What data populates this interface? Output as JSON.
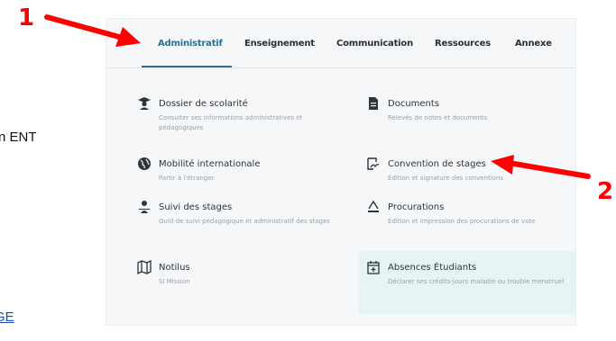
{
  "doc": {
    "ent_text": "n ENT",
    "link_text": "GE"
  },
  "tabs": [
    {
      "label": "Administratif",
      "active": true
    },
    {
      "label": "Enseignement"
    },
    {
      "label": "Communication"
    },
    {
      "label": "Ressources"
    },
    {
      "label": "Annexe"
    }
  ],
  "cards": {
    "scolarite": {
      "title": "Dossier de scolarité",
      "desc": "Consulter ses informations administratives et pédagogiques",
      "icon": "graduate-icon"
    },
    "documents": {
      "title": "Documents",
      "desc": "Relevés de notes et documents",
      "icon": "document-icon"
    },
    "mobilite": {
      "title": "Mobilité internationale",
      "desc": "Partir à l'étranger",
      "icon": "globe-icon"
    },
    "convention": {
      "title": "Convention de stages",
      "desc": "Edition et signature des conventions",
      "icon": "signature-icon"
    },
    "suivi": {
      "title": "Suivi des stages",
      "desc": "Outil de suivi pédagogique et administratif des stages",
      "icon": "person-icon"
    },
    "procurations": {
      "title": "Procurations",
      "desc": "Edition et impression des procurations de vote",
      "icon": "signing-icon"
    },
    "notilus": {
      "title": "Notilus",
      "desc": "SI Mission",
      "icon": "map-icon"
    },
    "absences": {
      "title": "Absences Étudiants",
      "desc": "Déclarer ses crédits-jours maladie ou trouble menstruel",
      "icon": "calendar-plus-icon"
    }
  },
  "annotations": {
    "one": "1",
    "two": "2"
  },
  "colors": {
    "accent": "#2b6f93",
    "annotation": "#ff0000",
    "highlight": "#e7f4f5"
  }
}
